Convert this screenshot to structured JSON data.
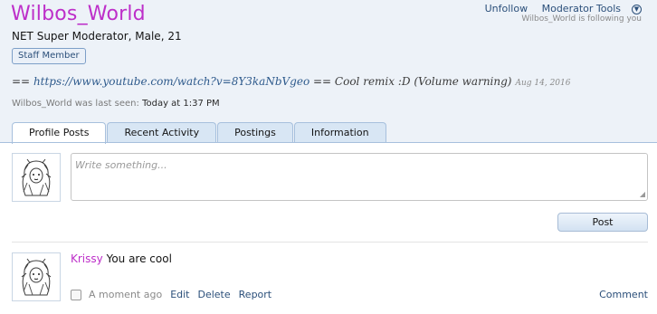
{
  "profile": {
    "username": "Wilbos_World",
    "user_title": "NET Super Moderator, Male, 21",
    "badge": "Staff Member",
    "status": {
      "prefix": "== ",
      "link": "https://www.youtube.com/watch?v=8Y3kaNbVgeo",
      "middle": " == ",
      "song": "Cool remix :D (Volume warning)",
      "date": "Aug 14, 2016"
    },
    "last_seen": {
      "label": "Wilbos_World was last seen:",
      "value": "Today at 1:37 PM"
    },
    "actions": {
      "unfollow": "Unfollow",
      "moderator_tools": "Moderator Tools"
    },
    "following_note": "Wilbos_World is following you"
  },
  "tabs": [
    "Profile Posts",
    "Recent Activity",
    "Postings",
    "Information"
  ],
  "composer": {
    "placeholder": "Write something...",
    "post_label": "Post"
  },
  "posts": [
    {
      "author": "Krissy",
      "text": "You are cool",
      "time": "A moment ago",
      "actions": [
        "Edit",
        "Delete",
        "Report"
      ],
      "comment_label": "Comment"
    }
  ],
  "colors": {
    "username": "#bd2fc9",
    "link": "#2b4f7a",
    "header_bg": "#edf2f8",
    "tab_bg": "#d8e6f4"
  }
}
